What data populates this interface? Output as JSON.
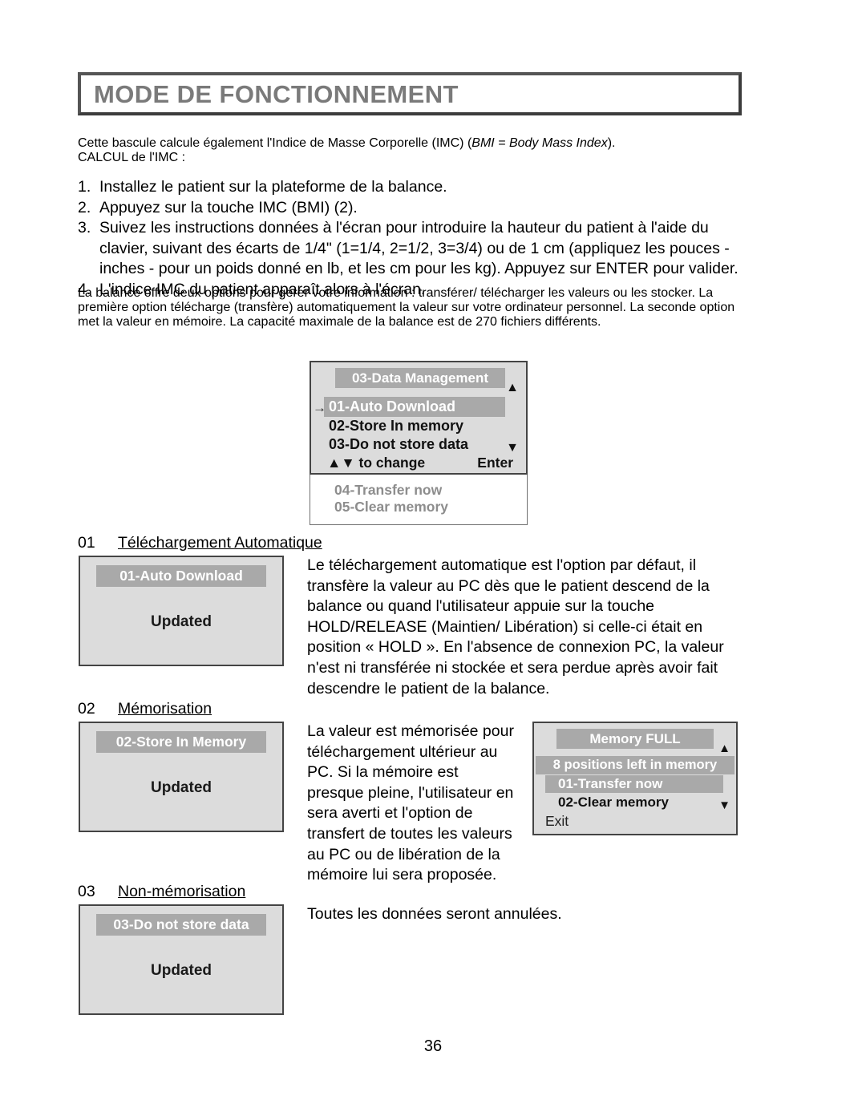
{
  "header": {
    "title": "MODE DE FONCTIONNEMENT"
  },
  "intro": {
    "line1_a": "Cette bascule calcule également l'Indice de Masse Corporelle (IMC) (",
    "line1_italic": "BMI = Body Mass Index",
    "line1_b": ").",
    "line2": "CALCUL de l'IMC :"
  },
  "steps": [
    {
      "num": "1.",
      "text": "Installez le patient sur la plateforme de la balance."
    },
    {
      "num": "2.",
      "text": "Appuyez sur la touche IMC (BMI) (2)."
    },
    {
      "num": "3.",
      "text": "Suivez les instructions données à l'écran pour introduire la hauteur du patient à l'aide du clavier, suivant des écarts de 1/4\" (1=1/4, 2=1/2, 3=3/4) ou de 1 cm (appliquez les pouces - inches - pour un poids donné en lb, et les cm pour les kg). Appuyez sur ENTER pour valider."
    },
    {
      "num": "4.",
      "text": "L'indice IMC du patient apparaît alors à l'écran."
    }
  ],
  "paragraph": "La balance offre deux options pour gérer votre information : transférer/ télécharger les valeurs ou les stocker. La première option télécharge (transfère) automatiquement la valeur sur votre ordinateur personnel. La seconde option met la valeur en mémoire. La capacité maximale de la balance est de 270 fichiers différents.",
  "data_management_panel": {
    "title": "03-Data Management",
    "selection_arrow": "→",
    "selected_item": "01-Auto Download",
    "item_2": "02-Store In memory",
    "item_3": "03-Do not store data",
    "scroll_up": "▲",
    "scroll_down": "▼",
    "footer_hint": "▲▼ to change",
    "footer_enter": "Enter",
    "ghost_item_1": "04-Transfer now",
    "ghost_item_2": "05-Clear memory"
  },
  "section_01": {
    "number": "01",
    "label": "Téléchargement Automatique",
    "panel_title": "01-Auto Download",
    "panel_status": "Updated",
    "description": "Le téléchargement automatique est l'option par défaut, il transfère la valeur au PC dès que le patient descend de la balance ou quand l'utilisateur appuie sur la touche HOLD/RELEASE (Maintien/ Libération) si celle-ci était en position « HOLD ». En l'absence de connexion PC, la valeur n'est ni transférée ni stockée et sera perdue après avoir fait descendre le patient de la balance."
  },
  "section_02": {
    "number": "02",
    "label": "Mémorisation",
    "panel_title": "02-Store In Memory",
    "panel_status": "Updated",
    "description": "La valeur est mémorisée pour téléchargement ultérieur au PC. Si la mémoire est presque pleine, l'utilisateur en sera averti et l'option de transfert de toutes les valeurs au PC ou de libération de la mémoire lui sera proposée."
  },
  "memory_full_panel": {
    "title": "Memory FULL",
    "positions_left": "8 positions left in memory",
    "selected_item": "01-Transfer now",
    "item_2": "02-Clear memory",
    "exit_label": "Exit",
    "scroll_up": "▲",
    "scroll_down": "▼"
  },
  "section_03": {
    "number": "03",
    "label": "Non-mémorisation",
    "panel_title": "03-Do not store data",
    "panel_status": "Updated",
    "description": "Toutes les données seront annulées."
  },
  "footer": {
    "page_number": "36"
  },
  "colors": {
    "lcd_background": "#dcdcdc",
    "lcd_highlight": "#a9a9a9",
    "lcd_border": "#444444",
    "header_text": "#7a7a7a",
    "ghost_text": "#8d8d8d"
  }
}
